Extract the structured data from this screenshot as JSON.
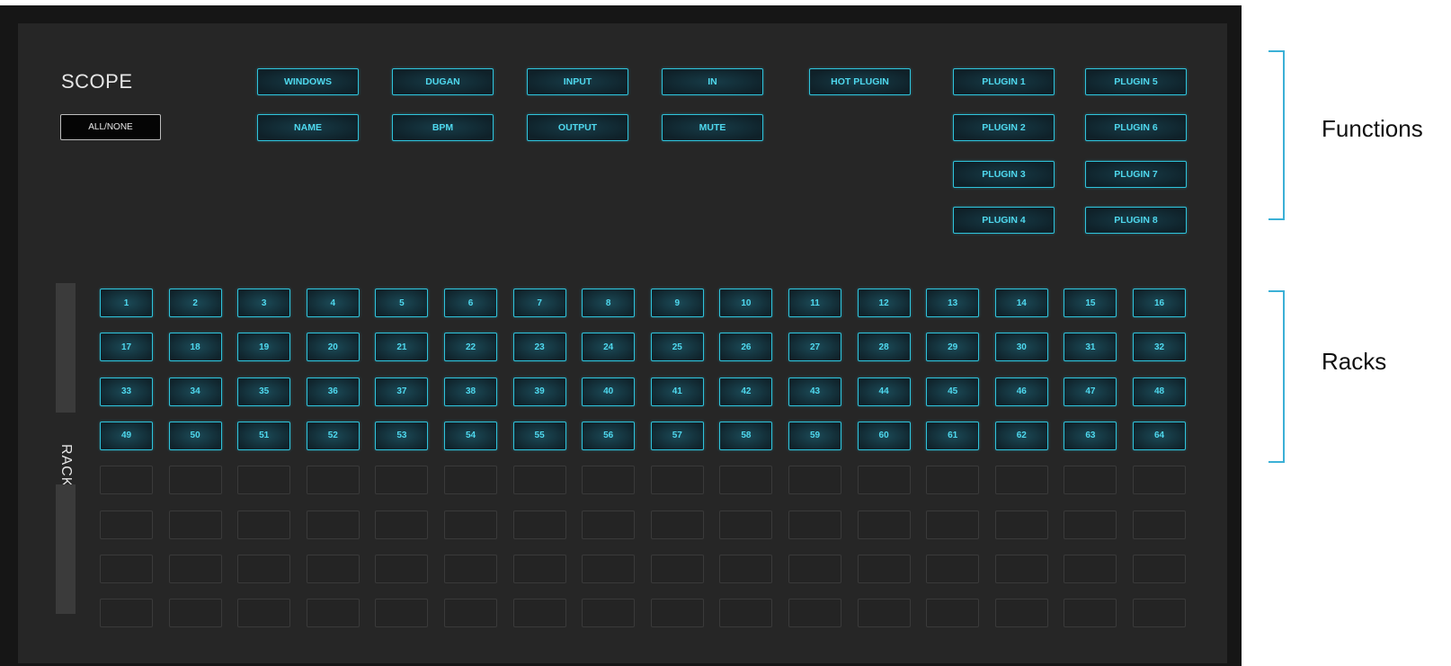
{
  "scope": {
    "title": "SCOPE",
    "all_none_label": "ALL/NONE"
  },
  "functions": {
    "row1": [
      "WINDOWS",
      "DUGAN",
      "INPUT",
      "IN"
    ],
    "row2": [
      "NAME",
      "BPM",
      "OUTPUT",
      "MUTE"
    ],
    "hot_plugin": "HOT PLUGIN",
    "plugins_col1": [
      "PLUGIN 1",
      "PLUGIN 2",
      "PLUGIN 3",
      "PLUGIN 4"
    ],
    "plugins_col2": [
      "PLUGIN 5",
      "PLUGIN 6",
      "PLUGIN 7",
      "PLUGIN 8"
    ]
  },
  "racks": {
    "label": "RACKS",
    "columns": 16,
    "filled_rows": 4,
    "empty_rows": 4,
    "numbers": [
      "1",
      "2",
      "3",
      "4",
      "5",
      "6",
      "7",
      "8",
      "9",
      "10",
      "11",
      "12",
      "13",
      "14",
      "15",
      "16",
      "17",
      "18",
      "19",
      "20",
      "21",
      "22",
      "23",
      "24",
      "25",
      "26",
      "27",
      "28",
      "29",
      "30",
      "31",
      "32",
      "33",
      "34",
      "35",
      "36",
      "37",
      "38",
      "39",
      "40",
      "41",
      "42",
      "43",
      "44",
      "45",
      "46",
      "47",
      "48",
      "49",
      "50",
      "51",
      "52",
      "53",
      "54",
      "55",
      "56",
      "57",
      "58",
      "59",
      "60",
      "61",
      "62",
      "63",
      "64"
    ]
  },
  "annotations": {
    "functions_label": "Functions",
    "racks_label": "Racks",
    "bracket_color": "#3bb0d6"
  },
  "colors": {
    "accent": "#2fc4dc",
    "button_text": "#4fd8ee",
    "panel_bg": "#262626",
    "frame_bg": "#161616"
  }
}
